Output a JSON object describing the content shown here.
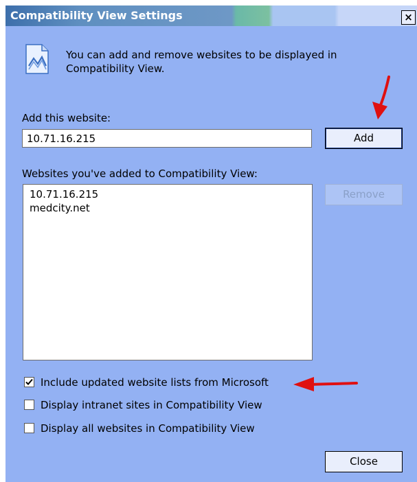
{
  "window": {
    "title": "Compatibility View Settings",
    "close_glyph": "×"
  },
  "intro": {
    "icon": "compatibility-view-icon",
    "text": "You can add and remove websites to be displayed in Compatibility View."
  },
  "add_site": {
    "label": "Add this website:",
    "value": "10.71.16.215",
    "button_label": "Add"
  },
  "site_list": {
    "label": "Websites you've added to Compatibility View:",
    "items": [
      "10.71.16.215",
      "medcity.net"
    ],
    "remove_label": "Remove"
  },
  "options": [
    {
      "label": "Include updated website lists from Microsoft",
      "checked": true
    },
    {
      "label": "Display intranet sites in Compatibility View",
      "checked": false
    },
    {
      "label": "Display all websites in Compatibility View",
      "checked": false
    }
  ],
  "footer": {
    "close_label": "Close"
  },
  "colors": {
    "window_bg": "#93b1f3",
    "arrow": "#e01010"
  }
}
